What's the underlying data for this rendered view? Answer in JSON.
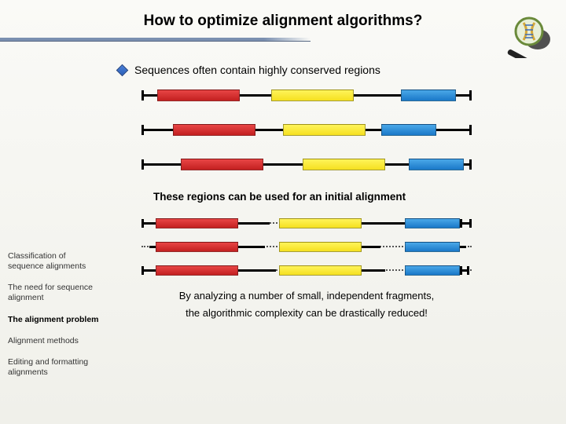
{
  "title": "How to optimize alignment algorithms?",
  "bullet": "Sequences often contain highly conserved regions",
  "caption": "These regions can be used for an initial alignment",
  "body_line1": "By analyzing a number of small, independent fragments,",
  "body_line2": "the algorithmic complexity can be drastically reduced!",
  "sidebar": {
    "item1": "Classification of sequence alignments",
    "item2": "The need for sequence alignment",
    "item3": "The alignment problem",
    "item4": "Alignment methods",
    "item5": "Editing and formatting alignments"
  }
}
